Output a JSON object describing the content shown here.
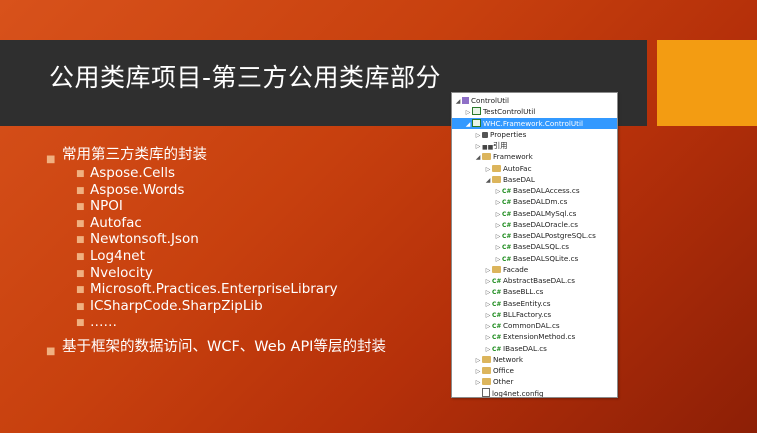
{
  "slide": {
    "title": "公用类库项目-第三方公用类库部分",
    "bullets": [
      {
        "text": "常用第三方类库的封装",
        "sub": [
          "Aspose.Cells",
          "Aspose.Words",
          "NPOI",
          "Autofac",
          "Newtonsoft.Json",
          "Log4net",
          "Nvelocity",
          "Microsoft.Practices.EnterpriseLibrary",
          "ICSharpCode.SharpZipLib",
          "……"
        ]
      },
      {
        "text": "基于框架的数据访问、WCF、Web API等层的封装",
        "sub": []
      }
    ]
  },
  "solution_tree": {
    "items": [
      {
        "label": "ControlUtil",
        "icon": "solution-icon",
        "expanded": true,
        "depth": 0
      },
      {
        "label": "TestControlUtil",
        "icon": "project-icon",
        "expanded": false,
        "depth": 1
      },
      {
        "label": "WHC.Framework.ControlUtil",
        "icon": "project-icon",
        "expanded": true,
        "depth": 1,
        "selected": true
      },
      {
        "label": "Properties",
        "icon": "wrench-icon",
        "expanded": false,
        "depth": 2
      },
      {
        "label": "引用",
        "icon": "references-icon",
        "expanded": false,
        "depth": 2
      },
      {
        "label": "Framework",
        "icon": "folder-icon",
        "expanded": true,
        "depth": 2
      },
      {
        "label": "AutoFac",
        "icon": "folder-icon",
        "expanded": false,
        "depth": 3
      },
      {
        "label": "BaseDAL",
        "icon": "folder-icon",
        "expanded": true,
        "depth": 3
      },
      {
        "label": "BaseDALAccess.cs",
        "icon": "csharp-file-icon",
        "expanded": false,
        "depth": 4
      },
      {
        "label": "BaseDALDm.cs",
        "icon": "csharp-file-icon",
        "expanded": false,
        "depth": 4
      },
      {
        "label": "BaseDALMySql.cs",
        "icon": "csharp-file-icon",
        "expanded": false,
        "depth": 4
      },
      {
        "label": "BaseDALOracle.cs",
        "icon": "csharp-file-icon",
        "expanded": false,
        "depth": 4
      },
      {
        "label": "BaseDALPostgreSQL.cs",
        "icon": "csharp-file-icon",
        "expanded": false,
        "depth": 4
      },
      {
        "label": "BaseDALSQL.cs",
        "icon": "csharp-file-icon",
        "expanded": false,
        "depth": 4
      },
      {
        "label": "BaseDALSQLite.cs",
        "icon": "csharp-file-icon",
        "expanded": false,
        "depth": 4
      },
      {
        "label": "Facade",
        "icon": "folder-icon",
        "expanded": false,
        "depth": 3
      },
      {
        "label": "AbstractBaseDAL.cs",
        "icon": "csharp-file-icon",
        "expanded": false,
        "depth": 3
      },
      {
        "label": "BaseBLL.cs",
        "icon": "csharp-file-icon",
        "expanded": false,
        "depth": 3
      },
      {
        "label": "BaseEntity.cs",
        "icon": "csharp-file-icon",
        "expanded": false,
        "depth": 3
      },
      {
        "label": "BLLFactory.cs",
        "icon": "csharp-file-icon",
        "expanded": false,
        "depth": 3
      },
      {
        "label": "CommonDAL.cs",
        "icon": "csharp-file-icon",
        "expanded": false,
        "depth": 3
      },
      {
        "label": "ExtensionMethod.cs",
        "icon": "csharp-file-icon",
        "expanded": false,
        "depth": 3
      },
      {
        "label": "IBaseDAL.cs",
        "icon": "csharp-file-icon",
        "expanded": false,
        "depth": 3
      },
      {
        "label": "Network",
        "icon": "folder-icon",
        "expanded": false,
        "depth": 2
      },
      {
        "label": "Office",
        "icon": "folder-icon",
        "expanded": false,
        "depth": 2
      },
      {
        "label": "Other",
        "icon": "folder-icon",
        "expanded": false,
        "depth": 2
      },
      {
        "label": "log4net.config",
        "icon": "config-file-icon",
        "expanded": false,
        "depth": 2
      }
    ]
  },
  "colors": {
    "accent": "#f39c12",
    "title_band": "#2f2f2f",
    "selection": "#3399ff"
  }
}
